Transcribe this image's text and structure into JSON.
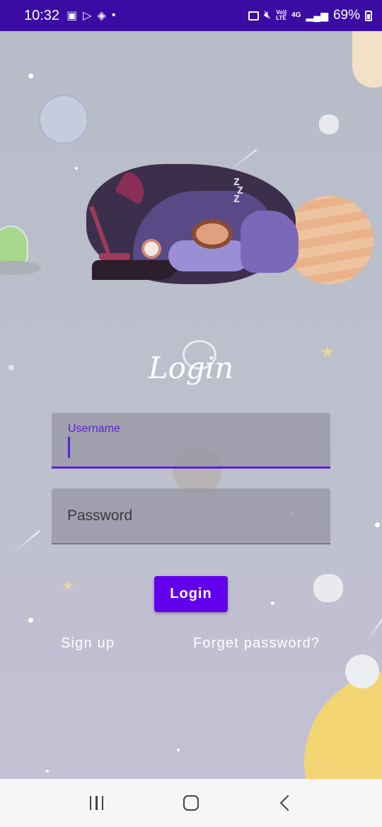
{
  "status_bar": {
    "time": "10:32",
    "network_top": "Vo))",
    "network_bottom": "LTE",
    "data_type": "4G",
    "battery_percent": "69%"
  },
  "app": {
    "title": "Login",
    "username_label": "Username",
    "username_value": "",
    "password_placeholder": "Password",
    "login_button": "Login",
    "signup_link": "Sign up",
    "forget_link": "Forget password?"
  },
  "colors": {
    "status_bar": "#3a0ca3",
    "accent": "#6200ee",
    "focus_underline": "#5b21d6"
  },
  "icons": {
    "status_left": [
      "gallery-icon",
      "play-store-icon",
      "app-icon"
    ],
    "status_right": [
      "battery-saver-icon",
      "mute-icon",
      "signal-icon",
      "battery-icon"
    ],
    "nav": [
      "recents-icon",
      "home-icon",
      "back-icon"
    ]
  }
}
